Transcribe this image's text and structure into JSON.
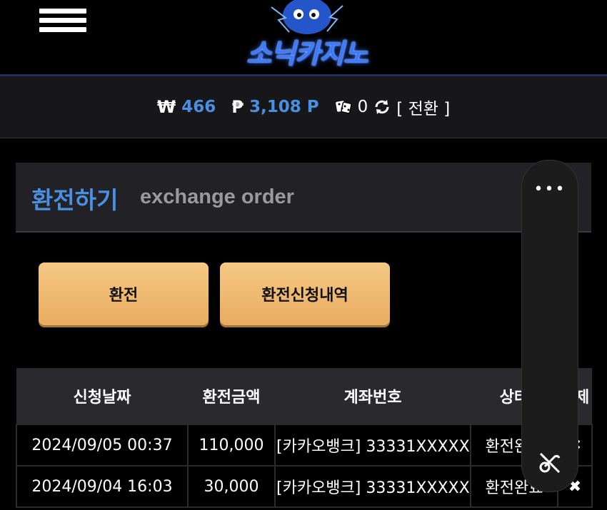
{
  "header": {
    "logo_text": "소닉카지노",
    "menu_icon": "hamburger-menu-icon"
  },
  "balance": {
    "won_symbol": "₩",
    "won_value": "466",
    "point_symbol": "₱",
    "point_value": "3,108 P",
    "dice_icon": "dice-icon",
    "dice_value": "0",
    "refresh_icon": "refresh-icon",
    "convert_label": "[ 전환 ]"
  },
  "panel": {
    "title": "환전하기",
    "subtitle": "exchange order"
  },
  "buttons": {
    "exchange": "환전",
    "history": "환전신청내역"
  },
  "table": {
    "headers": [
      "신청날짜",
      "환전금액",
      "계좌번호",
      "상태",
      "삭제"
    ],
    "rows": [
      {
        "date": "2024/09/05 00:37",
        "amount": "110,000",
        "account": "[카카오뱅크] 33331XXXXX",
        "status": "환전완료",
        "delete": "✖"
      },
      {
        "date": "2024/09/04 16:03",
        "amount": "30,000",
        "account": "[카카오뱅크] 33331XXXXX",
        "status": "환전완료",
        "delete": "✖"
      }
    ]
  },
  "floating_toolbar": {
    "more_label": "•••",
    "icon": "muted-broken-link-icon"
  },
  "colors": {
    "accent_blue": "#4a90e2",
    "button_gold": "#f0bb72",
    "panel_bg": "#222226"
  }
}
